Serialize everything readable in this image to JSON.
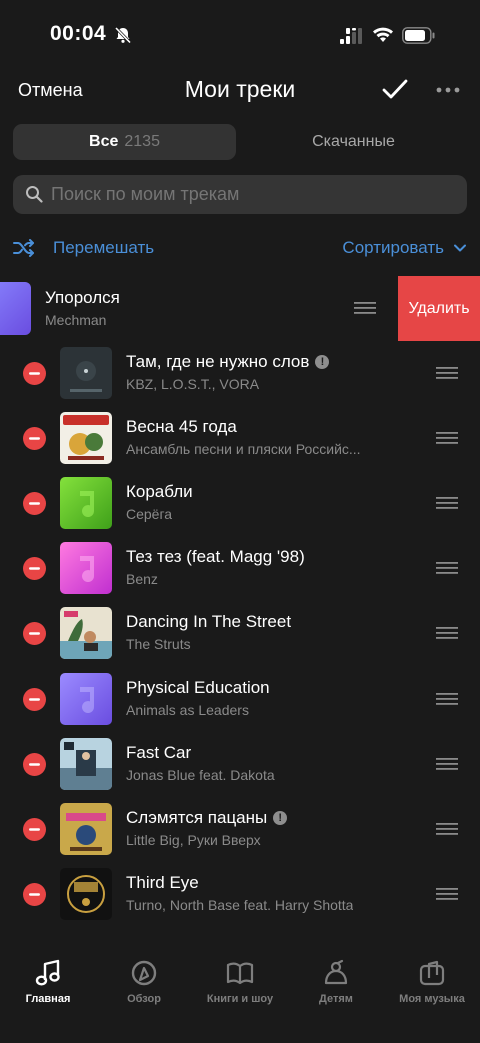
{
  "status_bar": {
    "time": "00:04"
  },
  "nav": {
    "cancel": "Отмена",
    "title": "Мои треки"
  },
  "segments": {
    "all": "Все",
    "all_count": "2135",
    "downloaded": "Скачанные"
  },
  "search": {
    "placeholder": "Поиск по моим трекам"
  },
  "actions": {
    "shuffle": "Перемешать",
    "sort": "Сортировать"
  },
  "swiped_track": {
    "title": "Упоролся",
    "artist": "Mechman",
    "delete_label": "Удалить"
  },
  "tracks": [
    {
      "title": "Там, где не нужно слов",
      "artist": "KBZ, L.O.S.T., VORA",
      "explicit": true
    },
    {
      "title": "Весна 45 года",
      "artist": "Ансамбль песни и пляски Российс...",
      "explicit": false
    },
    {
      "title": "Корабли",
      "artist": "Серёга",
      "explicit": false
    },
    {
      "title": "Тез тез (feat. Magg '98)",
      "artist": "Benz",
      "explicit": false
    },
    {
      "title": "Dancing In The Street",
      "artist": "The Struts",
      "explicit": false
    },
    {
      "title": "Physical Education",
      "artist": "Animals as Leaders",
      "explicit": false
    },
    {
      "title": "Fast Car",
      "artist": "Jonas Blue feat. Dakota",
      "explicit": false
    },
    {
      "title": "Слэмятся пацаны",
      "artist": "Little Big, Руки Вверх",
      "explicit": true
    },
    {
      "title": "Third Eye",
      "artist": "Turno, North Base feat. Harry Shotta",
      "explicit": false
    }
  ],
  "tabbar": {
    "items": [
      {
        "label": "Главная",
        "icon": "music-note-icon",
        "active": true
      },
      {
        "label": "Обзор",
        "icon": "compass-play-icon",
        "active": false
      },
      {
        "label": "Книги и шоу",
        "icon": "book-mic-icon",
        "active": false
      },
      {
        "label": "Детям",
        "icon": "kids-icon",
        "active": false
      },
      {
        "label": "Моя музыка",
        "icon": "my-music-icon",
        "active": false
      }
    ]
  },
  "colors": {
    "accent": "#4a8fd8",
    "delete": "#e64646",
    "remove": "#e84545",
    "background": "#1a1a1a"
  }
}
